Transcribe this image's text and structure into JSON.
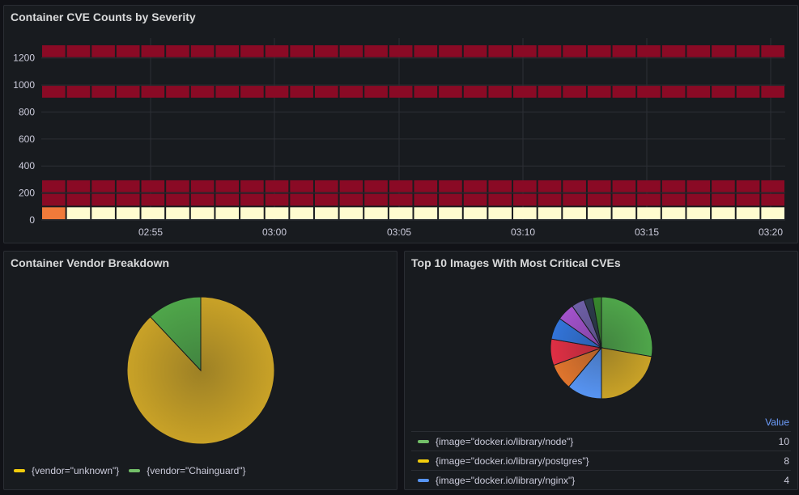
{
  "panels": {
    "heatmap": {
      "title": "Container CVE Counts by Severity",
      "y_ticks": [
        "1200",
        "1000",
        "800",
        "600",
        "400",
        "200",
        "0"
      ],
      "x_ticks": [
        "02:55",
        "03:00",
        "03:05",
        "03:10",
        "03:15",
        "03:20"
      ]
    },
    "vendor": {
      "title": "Container Vendor Breakdown",
      "legend": [
        {
          "label": "{vendor=\"unknown\"}",
          "color": "#c9a227"
        },
        {
          "label": "{vendor=\"Chainguard\"}",
          "color": "#4fa64a"
        }
      ]
    },
    "top_images": {
      "title": "Top 10 Images With Most Critical CVEs",
      "table_header": "Value",
      "rows": [
        {
          "label": "{image=\"docker.io/library/node\"}",
          "value": "10",
          "color": "#56a64b"
        },
        {
          "label": "{image=\"docker.io/library/postgres\"}",
          "value": "8",
          "color": "#f2cc0c"
        },
        {
          "label": "{image=\"docker.io/library/nginx\"}",
          "value": "4",
          "color": "#5794f2"
        }
      ]
    }
  },
  "chart_data": [
    {
      "type": "heatmap",
      "title": "Container CVE Counts by Severity",
      "ylim": [
        0,
        1300
      ],
      "x_ticks": [
        "02:55",
        "03:00",
        "03:05",
        "03:10",
        "03:15",
        "03:20"
      ],
      "y_ticks": [
        0,
        200,
        400,
        600,
        800,
        1000,
        1200
      ],
      "time_buckets": 30,
      "bands": [
        {
          "y_from": 1200,
          "y_to": 1300,
          "color": "#8a0a25"
        },
        {
          "y_from": 900,
          "y_to": 1000,
          "color": "#8a0a25"
        },
        {
          "y_from": 200,
          "y_to": 300,
          "color": "#8a0a25"
        },
        {
          "y_from": 100,
          "y_to": 200,
          "color": "#8a0a25"
        },
        {
          "y_from": 0,
          "y_to": 100,
          "color": "#fffccf",
          "first_bucket_color": "#f07a3a"
        }
      ]
    },
    {
      "type": "pie",
      "title": "Container Vendor Breakdown",
      "labels": [
        "{vendor=\"unknown\"}",
        "{vendor=\"Chainguard\"}"
      ],
      "values": [
        88,
        12
      ],
      "colors": [
        "#c9a227",
        "#4fa64a"
      ]
    },
    {
      "type": "pie",
      "title": "Top 10 Images With Most Critical CVEs",
      "labels": [
        "{image=\"docker.io/library/node\"}",
        "{image=\"docker.io/library/postgres\"}",
        "{image=\"docker.io/library/nginx\"}"
      ],
      "values": [
        10,
        8,
        4,
        3,
        3,
        2.5,
        2,
        1.5,
        1,
        1
      ],
      "colors": [
        "#4fa64a",
        "#c9a227",
        "#5794f2",
        "#e0752d",
        "#e02f44",
        "#3274d9",
        "#a352cc",
        "#6e5fa6",
        "#2c3a4a",
        "#37872d"
      ]
    }
  ]
}
